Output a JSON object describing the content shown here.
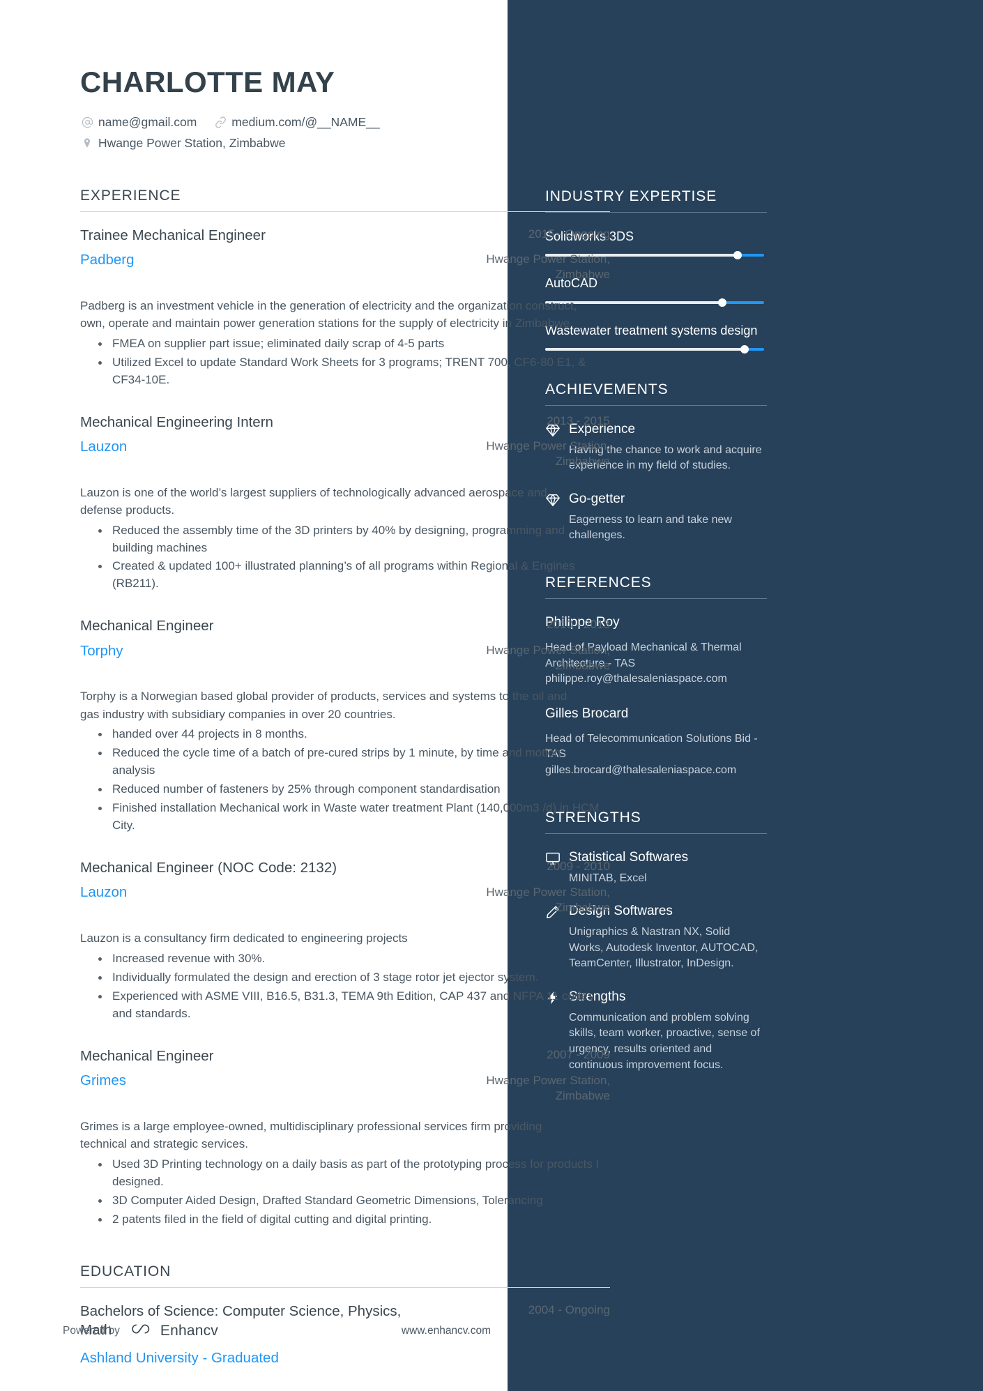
{
  "header": {
    "name": "CHARLOTTE MAY",
    "contacts": [
      {
        "icon": "at-icon",
        "text": "name@gmail.com"
      },
      {
        "icon": "link-icon",
        "text": "medium.com/@__NAME__"
      }
    ],
    "location": {
      "icon": "location-pin-icon",
      "text": "Hwange Power Station, Zimbabwe"
    }
  },
  "experience": {
    "title": "EXPERIENCE",
    "entries": [
      {
        "job_title": "Trainee Mechanical Engineer",
        "company": "Padberg",
        "date": "2015 - Ongoing",
        "location": "Hwange Power Station, Zimbabwe",
        "description": "Padberg is an investment vehicle in the generation of electricity and the organization construct, own, operate and maintain power generation stations for the supply of electricity in Zimbabwe",
        "bullets": [
          "FMEA on supplier part issue; eliminated daily scrap of 4-5 parts",
          "Utilized Excel to update Standard Work Sheets for 3 programs; TRENT 700, CF6-80 E1, & CF34-10E."
        ]
      },
      {
        "job_title": "Mechanical Engineering Intern",
        "company": "Lauzon",
        "date": "2013 - 2015",
        "location": "Hwange Power Station, Zimbabwe",
        "description": "Lauzon is one of the world’s largest suppliers of technologically advanced aerospace and defense products.",
        "bullets": [
          "Reduced the assembly time of the 3D printers by 40% by designing, programming and building machines",
          "Created & updated 100+ illustrated planning’s of all programs within Regional & Engines (RB211)."
        ]
      },
      {
        "job_title": "Mechanical Engineer",
        "company": "Torphy",
        "date": "2010 - 2013",
        "location": "Hwange Power Station, Zimbabwe",
        "description": "Torphy is a Norwegian based global provider of products, services and systems to the oil and gas industry with subsidiary companies in over 20 countries.",
        "bullets": [
          "handed over 44 projects in 8 months.",
          "Reduced the cycle time of a batch of pre-cured strips by 1 minute, by time and motion analysis",
          "Reduced number of fasteners by 25% through component standardisation",
          "Finished installation Mechanical work in Waste water treatment Plant (140,000m3 /d) in HCM City."
        ]
      },
      {
        "job_title": "Mechanical Engineer (NOC Code: 2132)",
        "company": "Lauzon",
        "date": "2009 - 2010",
        "location": "Hwange Power Station, Zimbabwe",
        "description": "Lauzon is a consultancy firm dedicated to engineering projects",
        "bullets": [
          "Increased revenue with 30%.",
          "Individually formulated the design and erection of 3 stage rotor jet ejector system.",
          "Experienced with ASME VIII, B16.5, B31.3, TEMA 9th Edition, CAP 437 and NFPA 11 codes and standards."
        ]
      },
      {
        "job_title": "Mechanical Engineer",
        "company": "Grimes",
        "date": "2007 - 2009",
        "location": "Hwange Power Station, Zimbabwe",
        "description": "Grimes is a large employee-owned, multidisciplinary professional services firm providing technical and strategic services.",
        "bullets": [
          "Used 3D Printing technology on a daily basis as part of the prototyping process for products I designed.",
          "3D Computer Aided Design, Drafted Standard Geometric Dimensions, Tolerancing",
          "2 patents filed in the field of digital cutting and digital printing."
        ]
      }
    ]
  },
  "education": {
    "title": "EDUCATION",
    "entries": [
      {
        "degree": "Bachelors of Science: Computer Science, Physics, Math",
        "school": "Ashland University - Graduated",
        "date": "2004 - Ongoing"
      }
    ]
  },
  "footer": {
    "powered_by": "Powered by",
    "brand": "Enhancv",
    "website": "www.enhancv.com"
  },
  "sidebar": {
    "industry_expertise": {
      "title": "INDUSTRY EXPERTISE",
      "skills": [
        {
          "name": "Solidworks 3DS",
          "level": 88
        },
        {
          "name": "AutoCAD",
          "level": 81
        },
        {
          "name": "Wastewater treatment systems design",
          "level": 91
        }
      ]
    },
    "achievements": {
      "title": "ACHIEVEMENTS",
      "items": [
        {
          "icon": "diamond-icon",
          "title": "Experience",
          "text": "Having the chance to work and acquire experience in my field of studies."
        },
        {
          "icon": "diamond-icon",
          "title": "Go-getter",
          "text": "Eagerness to learn and take new challenges."
        }
      ]
    },
    "references": {
      "title": "REFERENCES",
      "items": [
        {
          "name": "Philippe Roy",
          "lines": [
            "Head of Payload Mechanical & Thermal Architecture - TAS",
            "philippe.roy@thalesaleniaspace.com"
          ]
        },
        {
          "name": "Gilles Brocard",
          "lines": [
            "Head of Telecommunication Solutions Bid - TAS",
            "gilles.brocard@thalesaleniaspace.com"
          ]
        }
      ]
    },
    "strengths": {
      "title": "STRENGTHS",
      "items": [
        {
          "icon": "monitor-icon",
          "title": "Statistical Softwares",
          "text": "MINITAB, Excel"
        },
        {
          "icon": "pencil-icon",
          "title": "Design Softwares",
          "text": "Unigraphics & Nastran NX, Solid Works, Autodesk Inventor, AUTOCAD, TeamCenter, Illustrator, InDesign."
        },
        {
          "icon": "lightning-bolt-icon",
          "title": "Strengths",
          "text": "Communication and problem solving skills, team worker, proactive, sense of urgency, results oriented and continuous improvement focus."
        }
      ]
    }
  },
  "colors": {
    "sidebar_bg": "#27415a",
    "accent_blue": "#2196f3",
    "text_dark": "#3b4750"
  }
}
